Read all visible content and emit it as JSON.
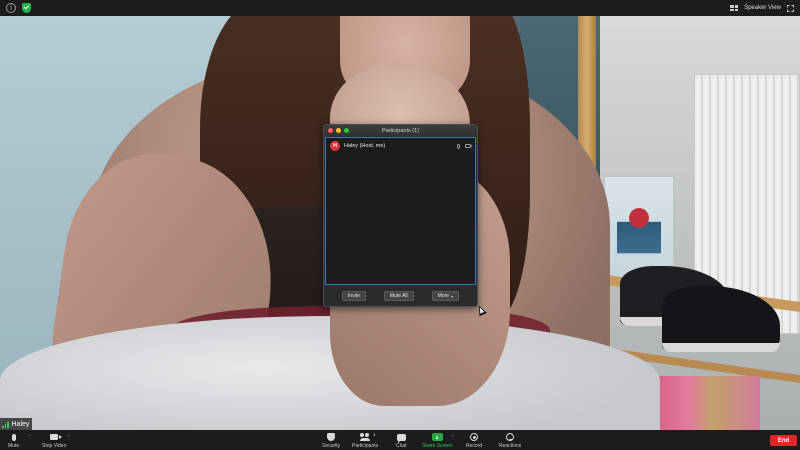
{
  "topbar": {
    "view_label": "Speaker View",
    "icons": [
      "info-icon",
      "shield-check-icon",
      "speaker-view-grid-icon",
      "fullscreen-icon"
    ]
  },
  "colors": {
    "encryption_green": "#23b14d",
    "share_screen_green": "#27a844",
    "end_red": "#e02828",
    "avatar_red": "#e0343d",
    "panel_border_blue": "#3a78c9"
  },
  "participants_panel": {
    "title": "Participants (1)",
    "participants": [
      {
        "initial": "H",
        "name": "Haley (Host, me)"
      }
    ],
    "buttons": {
      "invite": "Invite",
      "mute_all": "Mute All",
      "more": "More"
    }
  },
  "video": {
    "name_tag": "Haley"
  },
  "toolbar": {
    "mute": "Mute",
    "stop_video": "Stop Video",
    "security": "Security",
    "participants": "Participants",
    "participants_count": "1",
    "chat": "Chat",
    "share_screen": "Share Screen",
    "record": "Record",
    "reactions": "Reactions",
    "end": "End"
  }
}
